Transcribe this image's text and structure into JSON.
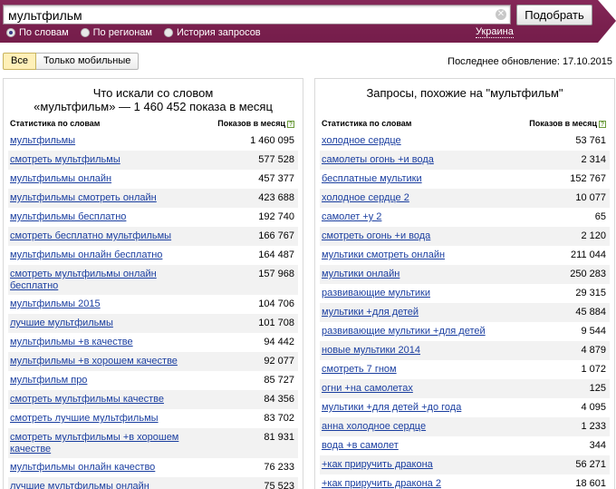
{
  "search": {
    "query": "мультфильм",
    "submit_label": "Подобрать"
  },
  "tabs": [
    {
      "label": "По словам",
      "checked": true
    },
    {
      "label": "По регионам",
      "checked": false
    },
    {
      "label": "История запросов",
      "checked": false
    }
  ],
  "region": "Украина",
  "filters": {
    "all_label": "Все",
    "mobile_label": "Только мобильные"
  },
  "last_update": "Последнее обновление: 17.10.2015",
  "left": {
    "title_line1": "Что искали со словом",
    "title_line2": "«мультфильм» — 1 460 452 показа в месяц",
    "col_words": "Статистика по словам",
    "col_shows": "Показов в месяц",
    "rows": [
      {
        "query": "мультфильмы",
        "count": "1 460 095"
      },
      {
        "query": "смотреть мультфильмы",
        "count": "577 528"
      },
      {
        "query": "мультфильмы онлайн",
        "count": "457 377"
      },
      {
        "query": "мультфильмы смотреть онлайн",
        "count": "423 688"
      },
      {
        "query": "мультфильмы бесплатно",
        "count": "192 740"
      },
      {
        "query": "смотреть бесплатно мультфильмы",
        "count": "166 767"
      },
      {
        "query": "мультфильмы онлайн бесплатно",
        "count": "164 487"
      },
      {
        "query": "смотреть мультфильмы онлайн бесплатно",
        "count": "157 968"
      },
      {
        "query": "мультфильмы 2015",
        "count": "104 706"
      },
      {
        "query": "лучшие мультфильмы",
        "count": "101 708"
      },
      {
        "query": "мультфильмы +в качестве",
        "count": "94 442"
      },
      {
        "query": "мультфильмы +в хорошем качестве",
        "count": "92 077"
      },
      {
        "query": "мультфильм про",
        "count": "85 727"
      },
      {
        "query": "смотреть мультфильмы качестве",
        "count": "84 356"
      },
      {
        "query": "смотреть лучшие мультфильмы",
        "count": "83 702"
      },
      {
        "query": "смотреть мультфильмы +в хорошем качестве",
        "count": "81 931"
      },
      {
        "query": "мультфильмы онлайн качество",
        "count": "76 233"
      },
      {
        "query": "лучшие мультфильмы онлайн",
        "count": "75 523"
      }
    ]
  },
  "right": {
    "title": "Запросы, похожие на \"мультфильм\"",
    "col_words": "Статистика по словам",
    "col_shows": "Показов в месяц",
    "rows": [
      {
        "query": "холодное сердце",
        "count": "53 761"
      },
      {
        "query": "самолеты огонь +и вода",
        "count": "2 314"
      },
      {
        "query": "бесплатные мультики",
        "count": "152 767"
      },
      {
        "query": "холодное сердце 2",
        "count": "10 077"
      },
      {
        "query": "самолет +у 2",
        "count": "65"
      },
      {
        "query": "смотреть огонь +и вода",
        "count": "2 120"
      },
      {
        "query": "мультики смотреть онлайн",
        "count": "211 044"
      },
      {
        "query": "мультики онлайн",
        "count": "250 283"
      },
      {
        "query": "развивающие мультики",
        "count": "29 315"
      },
      {
        "query": "мультики +для детей",
        "count": "45 884"
      },
      {
        "query": "развивающие мультики +для детей",
        "count": "9 544"
      },
      {
        "query": "новые мультики 2014",
        "count": "4 879"
      },
      {
        "query": "смотреть 7 гном",
        "count": "1 072"
      },
      {
        "query": "огни +на самолетах",
        "count": "125"
      },
      {
        "query": "мультики +для детей +до года",
        "count": "4 095"
      },
      {
        "query": "анна холодное сердце",
        "count": "1 233"
      },
      {
        "query": "вода +в самолет",
        "count": "344"
      },
      {
        "query": "+как приручить дракона",
        "count": "56 271"
      },
      {
        "query": "+как приручить дракона 2",
        "count": "18 601"
      }
    ]
  }
}
